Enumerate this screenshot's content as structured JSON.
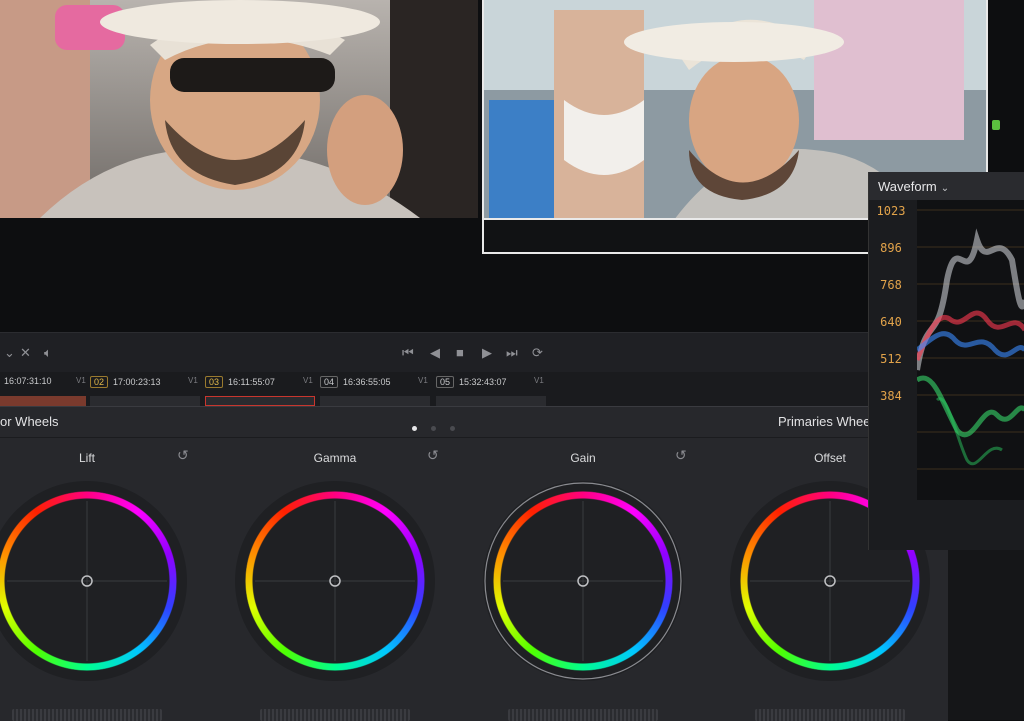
{
  "transport": {
    "icons": [
      "chevron-down-icon",
      "cut-icon",
      "speaker-icon",
      "skip-back-icon",
      "play-reverse-icon",
      "stop-icon",
      "play-icon",
      "skip-forward-icon",
      "loop-icon"
    ]
  },
  "clips": [
    {
      "num": "",
      "timecode": "16:07:31:10",
      "track": "V1"
    },
    {
      "num": "02",
      "timecode": "17:00:23:13",
      "track": "V1"
    },
    {
      "num": "03",
      "timecode": "16:11:55:07",
      "track": "V1"
    },
    {
      "num": "04",
      "timecode": "16:36:55:05",
      "track": "V1"
    },
    {
      "num": "05",
      "timecode": "15:32:43:07",
      "track": "V1"
    }
  ],
  "wheels_panel": {
    "title": "or Wheels",
    "mode": "Primaries Wheels",
    "page_count": 3,
    "active_page": 1,
    "wheels": [
      {
        "label": "Lift"
      },
      {
        "label": "Gamma"
      },
      {
        "label": "Gain"
      },
      {
        "label": "Offset"
      }
    ]
  },
  "scope": {
    "title": "Waveform",
    "ticks": [
      "1023",
      "896",
      "768",
      "640",
      "512",
      "384"
    ]
  },
  "colors": {
    "accent_orange": "#e2a34a",
    "panel_bg": "#27282c"
  }
}
